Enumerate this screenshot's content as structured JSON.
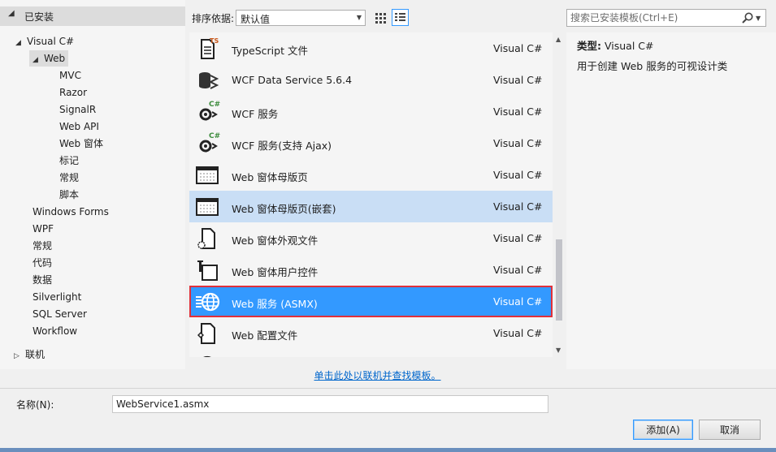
{
  "tree": {
    "installed_label": "已安装",
    "items": [
      {
        "label": "Visual C#",
        "toggle": "◢",
        "level": 1
      },
      {
        "label": "Web",
        "toggle": "◢",
        "level": 2,
        "selected": true
      },
      {
        "label": "MVC",
        "level": 3
      },
      {
        "label": "Razor",
        "level": 3
      },
      {
        "label": "SignalR",
        "level": 3
      },
      {
        "label": "Web API",
        "level": 3
      },
      {
        "label": "Web 窗体",
        "level": 3
      },
      {
        "label": "标记",
        "level": 3
      },
      {
        "label": "常规",
        "level": 3
      },
      {
        "label": "脚本",
        "level": 3
      },
      {
        "label": "Windows Forms",
        "level": 2
      },
      {
        "label": "WPF",
        "level": 2
      },
      {
        "label": "常规",
        "level": 2
      },
      {
        "label": "代码",
        "level": 2
      },
      {
        "label": "数据",
        "level": 2
      },
      {
        "label": "Silverlight",
        "level": 2
      },
      {
        "label": "SQL Server",
        "level": 2
      },
      {
        "label": "Workflow",
        "level": 2
      },
      {
        "label": "联机",
        "toggle": "▷",
        "level": 0
      }
    ]
  },
  "toolbar": {
    "sort_label": "排序依据:",
    "sort_value": "默认值"
  },
  "search": {
    "placeholder": "搜索已安装模板(Ctrl+E)"
  },
  "templates": [
    {
      "name": "TypeScript 文件",
      "lang": "Visual C#",
      "icon": "typescript-file-icon"
    },
    {
      "name": "WCF Data Service 5.6.4",
      "lang": "Visual C#",
      "icon": "wcf-data-service-icon"
    },
    {
      "name": "WCF 服务",
      "lang": "Visual C#",
      "icon": "wcf-service-icon"
    },
    {
      "name": "WCF 服务(支持 Ajax)",
      "lang": "Visual C#",
      "icon": "wcf-ajax-service-icon"
    },
    {
      "name": "Web 窗体母版页",
      "lang": "Visual C#",
      "icon": "master-page-icon"
    },
    {
      "name": "Web 窗体母版页(嵌套)",
      "lang": "Visual C#",
      "icon": "nested-master-page-icon",
      "state": "hover"
    },
    {
      "name": "Web 窗体外观文件",
      "lang": "Visual C#",
      "icon": "skin-file-icon"
    },
    {
      "name": "Web 窗体用户控件",
      "lang": "Visual C#",
      "icon": "user-control-icon"
    },
    {
      "name": "Web 服务 (ASMX)",
      "lang": "Visual C#",
      "icon": "web-service-globe-icon",
      "state": "selected"
    },
    {
      "name": "Web 配置文件",
      "lang": "Visual C#",
      "icon": "web-config-icon"
    },
    {
      "name": "",
      "lang": "",
      "icon": "globe-icon"
    }
  ],
  "description": {
    "type_label": "类型:",
    "type_value": "Visual C#",
    "text": "用于创建 Web 服务的可视设计类"
  },
  "online_link": "单击此处以联机并查找模板。",
  "name_field": {
    "label": "名称(N):",
    "value": "WebService1.asmx"
  },
  "buttons": {
    "add": "添加(A)",
    "cancel": "取消"
  },
  "colors": {
    "selection": "#3399ff",
    "hover": "#c9def5",
    "highlight_border": "#e0303a",
    "link": "#0066cc"
  }
}
